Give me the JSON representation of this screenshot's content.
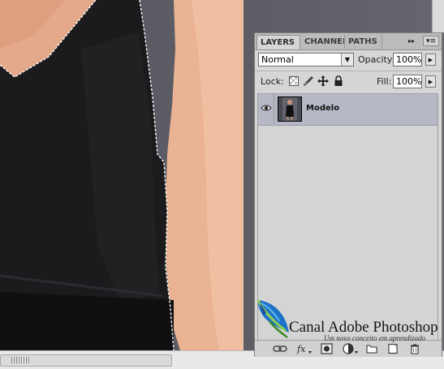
{
  "panel": {
    "tabs": [
      {
        "label": "LAYERS"
      },
      {
        "label": "CHANNELS"
      },
      {
        "label": "PATHS"
      }
    ],
    "collapse_glyph": "▸▸",
    "menu_glyph": "▾≡",
    "blend_mode": "Normal",
    "opacity_label": "Opacity:",
    "opacity_value": "100%",
    "lock_label": "Lock:",
    "fill_label": "Fill:",
    "fill_value": "100%",
    "lock_icons": [
      "lock-transparent-icon",
      "lock-image-icon",
      "lock-position-icon",
      "lock-all-icon"
    ],
    "layers": [
      {
        "name": "Modelo",
        "visible": true,
        "selected": true
      }
    ],
    "bottom_icons": [
      "link-layers-icon",
      "fx-icon",
      "layer-mask-icon",
      "adjustment-layer-icon",
      "new-group-icon",
      "new-layer-icon",
      "trash-icon"
    ]
  },
  "watermark": {
    "brand": "Canal Adobe Photoshop",
    "tagline": "Um novo conceito em aprendizado",
    "logo_icon": "feather-icon"
  },
  "colors": {
    "panel_bg": "#d6d6d6",
    "selected_row": "#b6b8c6",
    "canvas_bg": "#5d5d66"
  }
}
